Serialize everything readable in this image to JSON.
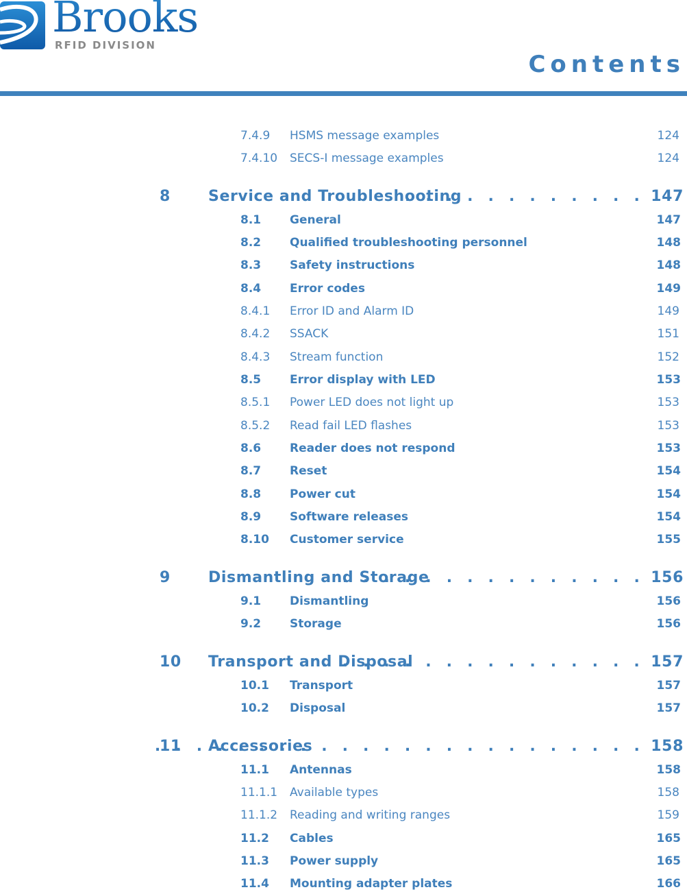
{
  "header": {
    "logo": {
      "brand": "Brooks",
      "division": "RFID DIVISION",
      "icon": "brooks-globe-icon"
    },
    "title": "Contents",
    "accent_color": "#3f7fba"
  },
  "toc": [
    {
      "level": 3,
      "num": "7.4.9",
      "title": "HSMS message examples",
      "page": "124"
    },
    {
      "level": 3,
      "num": "7.4.10",
      "title": "SECS-I message examples",
      "page": "124"
    },
    {
      "level": 1,
      "num": "8",
      "title": "Service and Troubleshooting",
      "leader": ". . . . . . . . . . . .",
      "page": "147"
    },
    {
      "level": 2,
      "num": "8.1",
      "title": "General",
      "page": "147"
    },
    {
      "level": 2,
      "num": "8.2",
      "title": "Qualified troubleshooting personnel",
      "page": "148"
    },
    {
      "level": 2,
      "num": "8.3",
      "title": "Safety instructions",
      "page": "148"
    },
    {
      "level": 2,
      "num": "8.4",
      "title": "Error codes",
      "page": "149"
    },
    {
      "level": 3,
      "num": "8.4.1",
      "title": "Error ID and Alarm ID",
      "page": "149"
    },
    {
      "level": 3,
      "num": "8.4.2",
      "title": "SSACK",
      "page": "151"
    },
    {
      "level": 3,
      "num": "8.4.3",
      "title": "Stream function",
      "page": "152"
    },
    {
      "level": 2,
      "num": "8.5",
      "title": "Error display with LED",
      "page": "153"
    },
    {
      "level": 3,
      "num": "8.5.1",
      "title": "Power LED does not light up",
      "page": "153"
    },
    {
      "level": 3,
      "num": "8.5.2",
      "title": "Read fail LED flashes",
      "page": "153"
    },
    {
      "level": 2,
      "num": "8.6",
      "title": "Reader does not respond",
      "page": "153"
    },
    {
      "level": 2,
      "num": "8.7",
      "title": "Reset",
      "page": "154"
    },
    {
      "level": 2,
      "num": "8.8",
      "title": "Power cut",
      "page": "154"
    },
    {
      "level": 2,
      "num": "8.9",
      "title": "Software releases",
      "page": "154"
    },
    {
      "level": 2,
      "num": "8.10",
      "title": "Customer service",
      "page": "155"
    },
    {
      "level": 1,
      "num": "9",
      "title": "Dismantling and Storage",
      "leader": ". . . . . . . . . . . . . . .",
      "page": "156"
    },
    {
      "level": 2,
      "num": "9.1",
      "title": "Dismantling",
      "page": "156"
    },
    {
      "level": 2,
      "num": "9.2",
      "title": "Storage",
      "page": "156"
    },
    {
      "level": 1,
      "num": "10",
      "title": "Transport and Disposal",
      "leader": ". . . . . . . . . . . . . . . .",
      "page": "157"
    },
    {
      "level": 2,
      "num": "10.1",
      "title": "Transport",
      "page": "157"
    },
    {
      "level": 2,
      "num": "10.2",
      "title": "Disposal",
      "page": "157"
    },
    {
      "level": 1,
      "num": "11",
      "title": "Accessories",
      "leader": ". . . . . . . . . . . . . . . . . . . . . . . .",
      "page": "158"
    },
    {
      "level": 2,
      "num": "11.1",
      "title": "Antennas",
      "page": "158"
    },
    {
      "level": 3,
      "num": "11.1.1",
      "title": "Available types",
      "page": "158"
    },
    {
      "level": 3,
      "num": "11.1.2",
      "title": "Reading and writing ranges",
      "page": "159"
    },
    {
      "level": 2,
      "num": "11.2",
      "title": "Cables",
      "page": "165"
    },
    {
      "level": 2,
      "num": "11.3",
      "title": "Power supply",
      "page": "165"
    },
    {
      "level": 2,
      "num": "11.4",
      "title": "Mounting adapter plates",
      "page": "166"
    }
  ]
}
